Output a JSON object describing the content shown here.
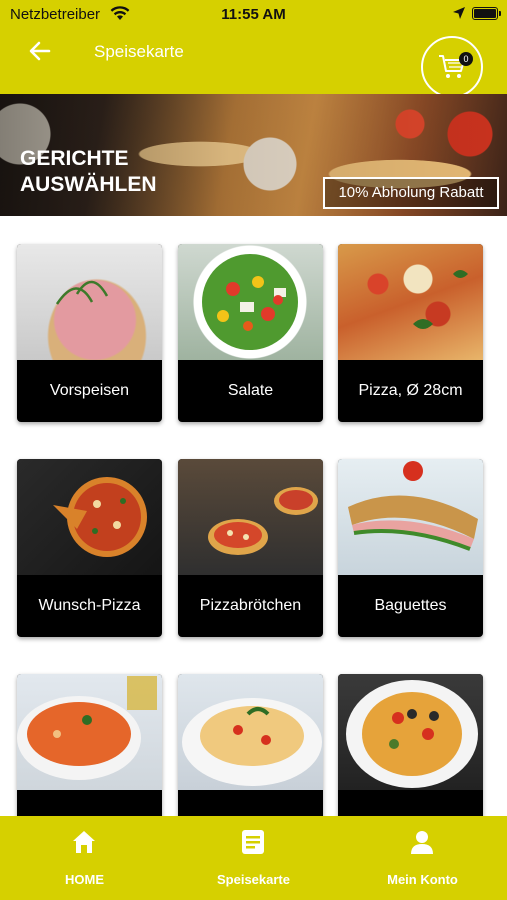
{
  "status_bar": {
    "carrier": "Netzbetreiber",
    "time": "11:55 AM"
  },
  "header": {
    "title": "Speisekarte",
    "cart_count": "0"
  },
  "banner": {
    "title": "GERICHTE\nAUSWÄHLEN",
    "badge": "10% Abholung Rabatt"
  },
  "categories": [
    {
      "label": "Vorspeisen",
      "icon": "ham-appetizer-image"
    },
    {
      "label": "Salate",
      "icon": "salad-image"
    },
    {
      "label": "Pizza, Ø 28cm",
      "icon": "pizza-image"
    },
    {
      "label": "Wunsch-Pizza",
      "icon": "custom-pizza-image"
    },
    {
      "label": "Pizzabrötchen",
      "icon": "pizza-roll-image"
    },
    {
      "label": "Baguettes",
      "icon": "baguette-image"
    },
    {
      "label": "",
      "icon": "gnocchi-image"
    },
    {
      "label": "",
      "icon": "pasta-image"
    },
    {
      "label": "",
      "icon": "spaghetti-image"
    }
  ],
  "bottom_nav": [
    {
      "label": "HOME",
      "icon": "home-icon"
    },
    {
      "label": "Speisekarte",
      "icon": "menu-list-icon"
    },
    {
      "label": "Mein Konto",
      "icon": "user-icon"
    }
  ],
  "colors": {
    "brand": "#d6d000",
    "card_bg": "#000000",
    "text_light": "#ffffff"
  }
}
